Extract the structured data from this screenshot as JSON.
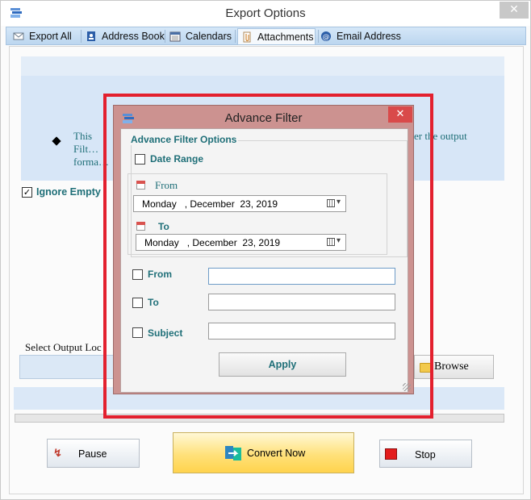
{
  "window": {
    "title": "Export Options",
    "close_glyph": "✕"
  },
  "tabs": [
    {
      "label": "Export All",
      "icon": "envelope-icon"
    },
    {
      "label": "Address Book",
      "icon": "address-book-icon"
    },
    {
      "label": "Calendars",
      "icon": "calendar-icon"
    },
    {
      "label": "Attachments",
      "icon": "paperclip-icon",
      "active": true
    },
    {
      "label": "Email Address",
      "icon": "at-sign-icon"
    }
  ],
  "info": {
    "text_left": "This Filt… forma…",
    "text_right": "er the output"
  },
  "ignore_empty": {
    "label": "Ignore Empty",
    "checked": true
  },
  "output": {
    "label": "Select Output Loc",
    "value": "",
    "browse_label": "Browse"
  },
  "progress": {
    "percent": 0
  },
  "actions": {
    "pause_label": "Pause",
    "convert_label": "Convert Now",
    "stop_label": "Stop"
  },
  "dialog": {
    "title": "Advance Filter",
    "close_glyph": "✕",
    "group_title": "Advance Filter Options",
    "date_range": {
      "label": "Date Range",
      "checked": false,
      "from_label": "From",
      "from_value": "Monday   , December  23, 2019",
      "to_label": "To",
      "to_value": "Monday   , December  23, 2019"
    },
    "from_filter": {
      "label": "From",
      "checked": false,
      "value": ""
    },
    "to_filter": {
      "label": "To",
      "checked": false,
      "value": ""
    },
    "subject_filter": {
      "label": "Subject",
      "checked": false,
      "value": ""
    },
    "apply_label": "Apply"
  },
  "colors": {
    "teal_text": "#1f6f78",
    "highlight_red": "#e3202e",
    "dialog_frame": "#cc9290",
    "info_panel": "#d7e6f7"
  }
}
